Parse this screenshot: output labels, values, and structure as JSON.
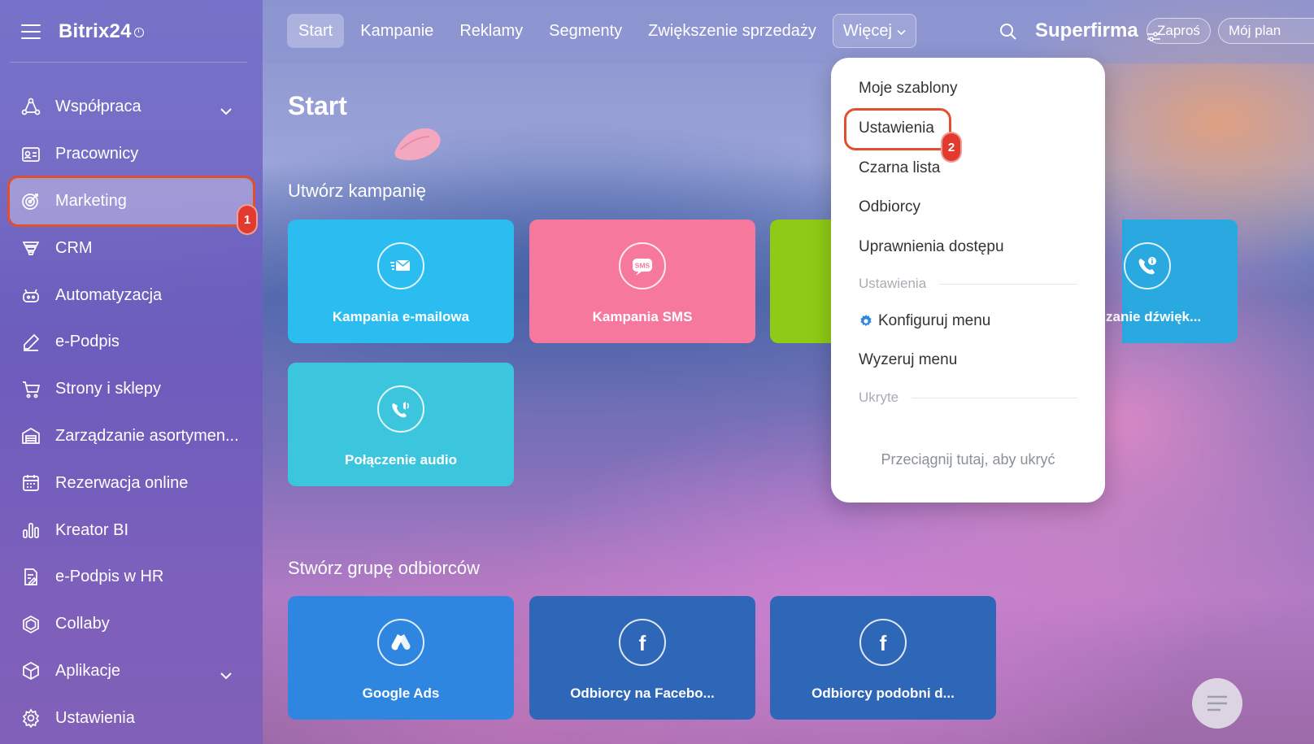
{
  "app": {
    "logo": "Bitrix24"
  },
  "sidebar": {
    "items": [
      {
        "label": "Współpraca",
        "icon": "collaboration-icon",
        "expandable": true
      },
      {
        "label": "Pracownicy",
        "icon": "employees-icon"
      },
      {
        "label": "Marketing",
        "icon": "target-icon",
        "active": true,
        "badge": "1"
      },
      {
        "label": "CRM",
        "icon": "crm-funnel-icon"
      },
      {
        "label": "Automatyzacja",
        "icon": "robot-icon"
      },
      {
        "label": "e-Podpis",
        "icon": "signature-pen-icon"
      },
      {
        "label": "Strony i sklepy",
        "icon": "cart-icon"
      },
      {
        "label": "Zarządzanie asortymen...",
        "icon": "warehouse-icon"
      },
      {
        "label": "Rezerwacja online",
        "icon": "calendar-icon"
      },
      {
        "label": "Kreator BI",
        "icon": "bar-chart-icon"
      },
      {
        "label": "e-Podpis w HR",
        "icon": "document-sign-icon"
      },
      {
        "label": "Collaby",
        "icon": "hexagon-icon"
      },
      {
        "label": "Aplikacje",
        "icon": "cube-icon",
        "expandable": true
      },
      {
        "label": "Ustawienia",
        "icon": "gear-icon"
      }
    ]
  },
  "topbar": {
    "tabs": [
      "Start",
      "Kampanie",
      "Reklamy",
      "Segmenty",
      "Zwiększenie sprzedaży"
    ],
    "more": "Więcej",
    "company": "Superfirma",
    "invite": "Zaproś",
    "plan": "Mój plan"
  },
  "main": {
    "title": "Start",
    "create_campaign": "Utwórz kampanię",
    "campaign_tiles": [
      {
        "label": "Kampania e-mailowa",
        "color": "#2bbdf0",
        "icon": "email-icon"
      },
      {
        "label": "Kampania SMS",
        "color": "#f6789c",
        "icon": "sms-icon"
      },
      {
        "label": "",
        "color": "#8fcb16",
        "icon": ""
      },
      {
        "label": "zanie dźwięk...",
        "color": "#2aa8e0",
        "icon": "phone-info-icon"
      },
      {
        "label": "Połączenie audio",
        "color": "#3cc6dd",
        "icon": "audio-call-icon"
      }
    ],
    "create_group": "Stwórz grupę odbiorców",
    "audience_tiles": [
      {
        "label": "Google Ads",
        "color": "#2f86e0",
        "icon": "google-ads-icon"
      },
      {
        "label": "Odbiorcy na Facebo...",
        "color": "#2e66b8",
        "icon": "facebook-icon"
      },
      {
        "label": "Odbiorcy podobni d...",
        "color": "#2e66b8",
        "icon": "facebook-icon"
      }
    ]
  },
  "dropdown": {
    "items": [
      "Moje szablony",
      "Ustawienia",
      "Czarna lista",
      "Odbiorcy",
      "Uprawnienia dostępu"
    ],
    "highlight_badge": "2",
    "section_settings": "Ustawienia",
    "configure": "Konfiguruj menu",
    "reset": "Wyzeruj menu",
    "section_hidden": "Ukryte",
    "drop_hint": "Przeciągnij tutaj, aby ukryć"
  },
  "colors": {
    "highlight": "#e0502f",
    "badge": "#e33a2f",
    "gear": "#2f86e0"
  }
}
